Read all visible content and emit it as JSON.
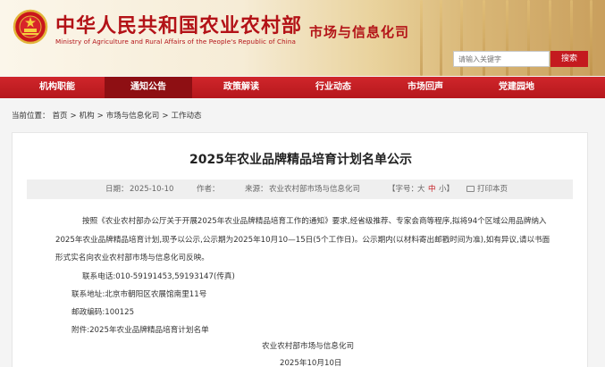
{
  "header": {
    "site_title": "中华人民共和国农业农村部",
    "site_subtitle": "Ministry of Agriculture and Rural Affairs of the People's Republic of China",
    "department": "市场与信息化司",
    "search_placeholder": "请输入关键字",
    "search_button": "搜索"
  },
  "nav": {
    "items": [
      {
        "label": "机构职能"
      },
      {
        "label": "通知公告"
      },
      {
        "label": "政策解读"
      },
      {
        "label": "行业动态"
      },
      {
        "label": "市场回声"
      },
      {
        "label": "党建园地"
      }
    ]
  },
  "breadcrumb": {
    "prefix": "当前位置：",
    "items": [
      "首页",
      "机构",
      "市场与信息化司",
      "工作动态"
    ],
    "separator": ">"
  },
  "article": {
    "title": "2025年农业品牌精品培育计划名单公示",
    "meta": {
      "date_label": "日期：",
      "date": "2025-10-10",
      "author_label": "作者：",
      "source_label": "来源：",
      "source": "农业农村部市场与信息化司",
      "font_label": "【字号：",
      "font_large": "大",
      "font_medium": "中",
      "font_small": "小】",
      "print_label": "打印本页"
    },
    "paragraphs": [
      "按照《农业农村部办公厅关于开展2025年农业品牌精品培育工作的通知》要求,经省级推荐、专家会商等程序,拟将94个区域公用品牌纳入",
      "2025年农业品牌精品培育计划,现予以公示,公示期为2025年10月10—15日(5个工作日)。公示期内(以材料寄出邮戳时间为准),如有异议,请以书面",
      "形式实名向农业农村部市场与信息化司反映。"
    ],
    "phone": "联系电话:010-59191453,59193147(传真)",
    "address": "联系地址:北京市朝阳区农展馆南里11号",
    "postcode": "邮政编码:100125",
    "attachment": "附件:2025年农业品牌精品培育计划名单",
    "signature": "农业农村部市场与信息化司",
    "sign_date": "2025年10月10日"
  },
  "colors": {
    "brand_red": "#c41a1f",
    "nav_active": "#8e0f13"
  }
}
